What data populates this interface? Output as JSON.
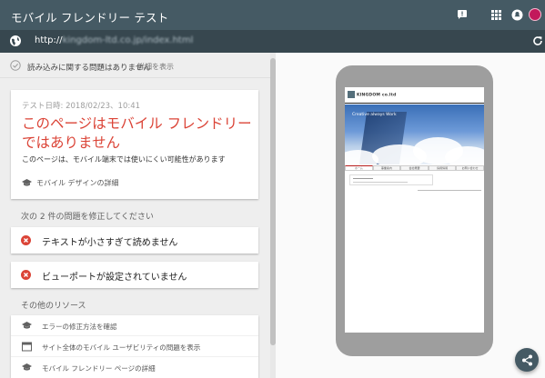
{
  "header": {
    "title": "モバイル フレンドリー テスト",
    "feedback_icon": "feedback-icon",
    "apps_icon": "apps-grid-icon",
    "notifications_icon": "notifications-icon",
    "avatar": "avatar"
  },
  "urlbar": {
    "scheme": "http://",
    "host": "kingdom-ltd.co.jp/index.html",
    "icon": "globe-icon",
    "reload_icon": "reload-icon"
  },
  "status": {
    "text": "読み込みに関する問題はありません",
    "link": "詳細を表示"
  },
  "result": {
    "date": "テスト日時: 2018/02/23、10:41",
    "verdict": "このページはモバイル フレンドリーではありません",
    "description": "このページは、モバイル端末では使いにくい可能性があります",
    "detail_link": "モバイル デザインの詳細"
  },
  "issues": {
    "heading": "次の 2 件の問題を修正してください",
    "items": [
      {
        "label": "テキストが小さすぎて読めません"
      },
      {
        "label": "ビューポートが設定されていません"
      }
    ]
  },
  "resources": {
    "heading": "その他のリソース",
    "items": [
      {
        "label": "エラーの修正方法を確認",
        "icon": "school-icon"
      },
      {
        "label": "サイト全体のモバイル ユーザビリティの問題を表示",
        "icon": "browser-window-icon"
      },
      {
        "label": "モバイル フレンドリー ページの詳細",
        "icon": "school-icon"
      }
    ]
  },
  "preview": {
    "site_logo": "KINGDOM co.ltd",
    "hero_text": "Creative always Work",
    "nav_items": [
      "ホーム",
      "事業案内",
      "会社概要",
      "採用情報",
      "お問い合わせ"
    ]
  },
  "colors": {
    "appbar": "#455a64",
    "urlbar": "#37474f",
    "error": "#db4437"
  }
}
